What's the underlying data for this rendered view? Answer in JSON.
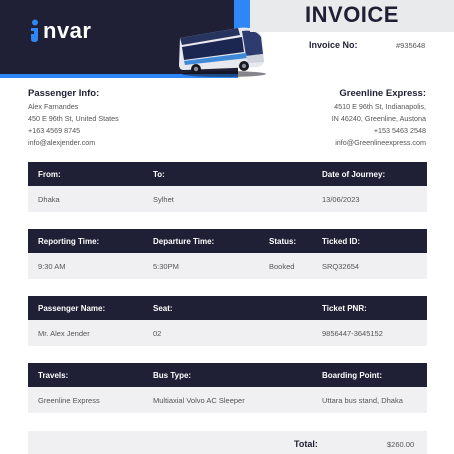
{
  "header": {
    "brand": "nvar",
    "title": "INVOICE",
    "invoice_no_label": "Invoice No:",
    "invoice_no_value": "#935648",
    "colors": {
      "dark": "#1f2036",
      "accent": "#2f86f6",
      "banner": "#e9eaec"
    }
  },
  "passenger_info": {
    "heading": "Passenger Info:",
    "name": "Alex Farnandes",
    "address": "450 E 96th St, United States",
    "phone": "+163 4569 8745",
    "email": "info@alexjender.com"
  },
  "company": {
    "heading": "Greenline Express:",
    "address_line1": "4510 E 96th St, Indianapolis,",
    "address_line2": "IN 46240, Greenline, Austona",
    "phone": "+153 5463 2548",
    "email": "info@Greenlineexpress.com"
  },
  "route_table": {
    "headers": [
      "From:",
      "To:",
      "Date of Journey:"
    ],
    "values": [
      "Dhaka",
      "Sylhet",
      "13/06/2023"
    ]
  },
  "time_table": {
    "headers": [
      "Reporting Time:",
      "Departure Time:",
      "Status:",
      "Ticked ID:"
    ],
    "values": [
      "9:30 AM",
      "5:30PM",
      "Booked",
      "SRQ32654"
    ]
  },
  "passenger_table": {
    "headers": [
      "Passenger Name:",
      "Seat:",
      "Ticket PNR:"
    ],
    "values": [
      "Mr. Alex Jender",
      "02",
      "9856447-3645152"
    ]
  },
  "travel_table": {
    "headers": [
      "Travels:",
      "Bus Type:",
      "Boarding Point:"
    ],
    "values": [
      "Greenline Express",
      "Multiaxial Volvo AC Sleeper",
      "Uttara bus stand, Dhaka"
    ]
  },
  "total": {
    "label": "Total:",
    "value": "$260.00"
  }
}
